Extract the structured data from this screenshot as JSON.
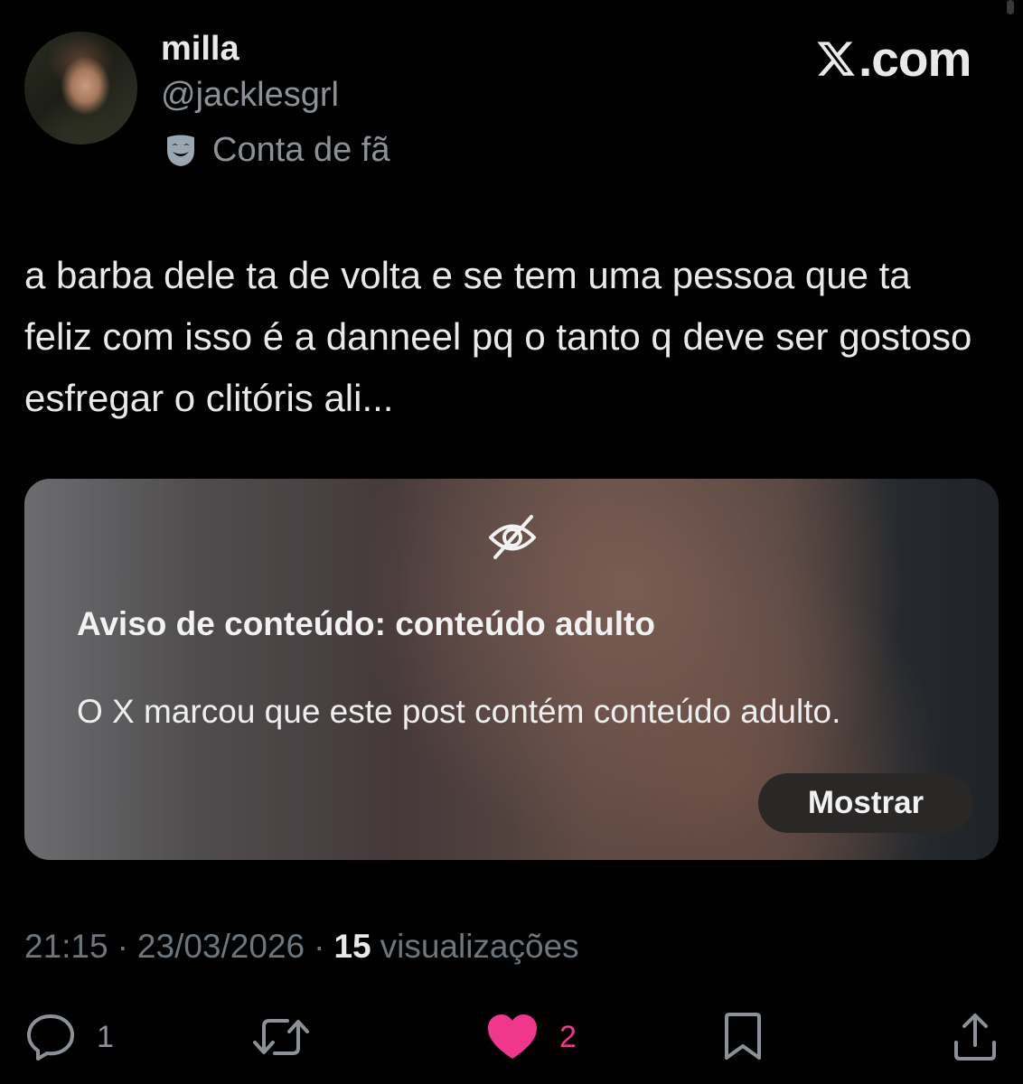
{
  "author": {
    "display_name": "milla",
    "handle": "@jacklesgrl",
    "badge_icon": "theater-mask-icon",
    "badge_label": "Conta de fã"
  },
  "brand": {
    "logo_icon": "x-logo-icon",
    "domain": ".com"
  },
  "post": {
    "text": "a barba dele ta de volta e se tem uma pessoa que ta feliz com isso é a danneel pq o tanto q deve ser gostoso esfregar o clitóris ali..."
  },
  "content_warning": {
    "icon": "eye-off-icon",
    "title": "Aviso de conteúdo: conteúdo adulto",
    "body": "O X marcou que este post contém conteúdo adulto.",
    "button_label": "Mostrar"
  },
  "meta": {
    "time": "21:15",
    "separator": "·",
    "date": "23/03/2026",
    "views_count": "15",
    "views_label": "visualizações"
  },
  "actions": {
    "reply": {
      "icon": "reply-icon",
      "count": "1"
    },
    "repost": {
      "icon": "repost-icon",
      "count": ""
    },
    "like": {
      "icon": "heart-icon",
      "count": "2",
      "liked": true
    },
    "bookmark": {
      "icon": "bookmark-icon"
    },
    "share": {
      "icon": "share-icon"
    }
  },
  "colors": {
    "background": "#000000",
    "primary_text": "#e7e9ea",
    "secondary_text": "#8b9197",
    "muted_text": "#6e767d",
    "like_pink": "#f0378e",
    "mask_icon": "#9aa7b3"
  }
}
